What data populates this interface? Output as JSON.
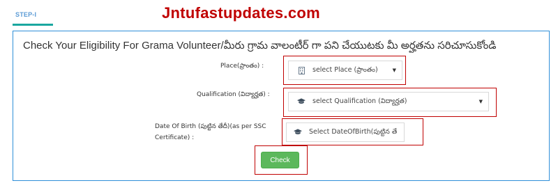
{
  "watermark": "Jntufastupdates.com",
  "step_tab": {
    "label": "STEP-I"
  },
  "form": {
    "heading": "Check Your Eligibility For Grama Volunteer/మీరు గ్రామ వాలంటీర్ గా పని చేయుటకు మీ అర్హతను సరిచూసుకోండి",
    "place": {
      "label": "Place(ప్రాంతం) :",
      "selected": "select Place (ప్రాంతం)",
      "icon": "building-icon"
    },
    "qualification": {
      "label": "Qualification (విద్యార్హత) :",
      "selected": "select Qualification (విద్యార్హత)",
      "icon": "graduation-cap-icon"
    },
    "dob": {
      "label_line1": "Date Of Birth (పుట్టిన తేదీ)(as per SSC",
      "label_line2": "Certificate) :",
      "placeholder": "Select DateOfBirth(పుట్టిన తే",
      "icon": "graduation-cap-icon"
    },
    "check_button": {
      "label": "Check",
      "color": "#5cb85c"
    }
  },
  "colors": {
    "highlight_border": "#c00000",
    "panel_border": "#2f8fd8",
    "tab_accent": "#1aa7a0"
  }
}
